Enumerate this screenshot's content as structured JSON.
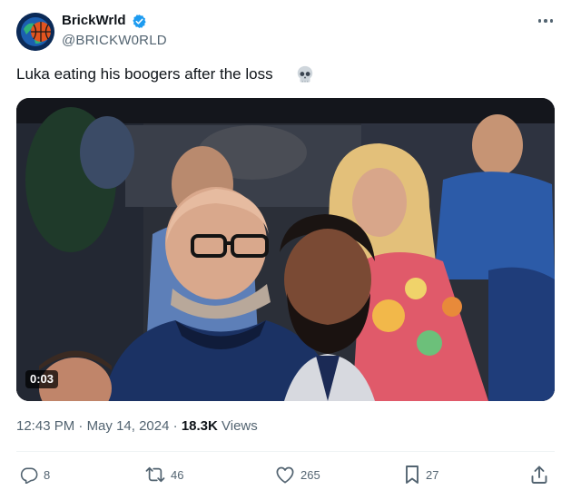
{
  "author": {
    "display_name": "BrickWrld",
    "handle": "@BRICKW0RLD",
    "verified": true,
    "avatar_icon": "basketball-globe-icon"
  },
  "post": {
    "text": "Luka eating his boogers after the loss",
    "emoji_icon": "skull-icon"
  },
  "media": {
    "type": "video",
    "duration": "0:03"
  },
  "meta": {
    "time": "12:43 PM",
    "separator": "·",
    "date": "May 14, 2024",
    "views_count": "18.3K",
    "views_label": "Views"
  },
  "actions": {
    "replies": "8",
    "reposts": "46",
    "likes": "265",
    "bookmarks": "27"
  },
  "colors": {
    "text_primary": "#0f1419",
    "text_secondary": "#536471",
    "verified_blue": "#1d9bf0",
    "divider": "#eff3f4"
  }
}
